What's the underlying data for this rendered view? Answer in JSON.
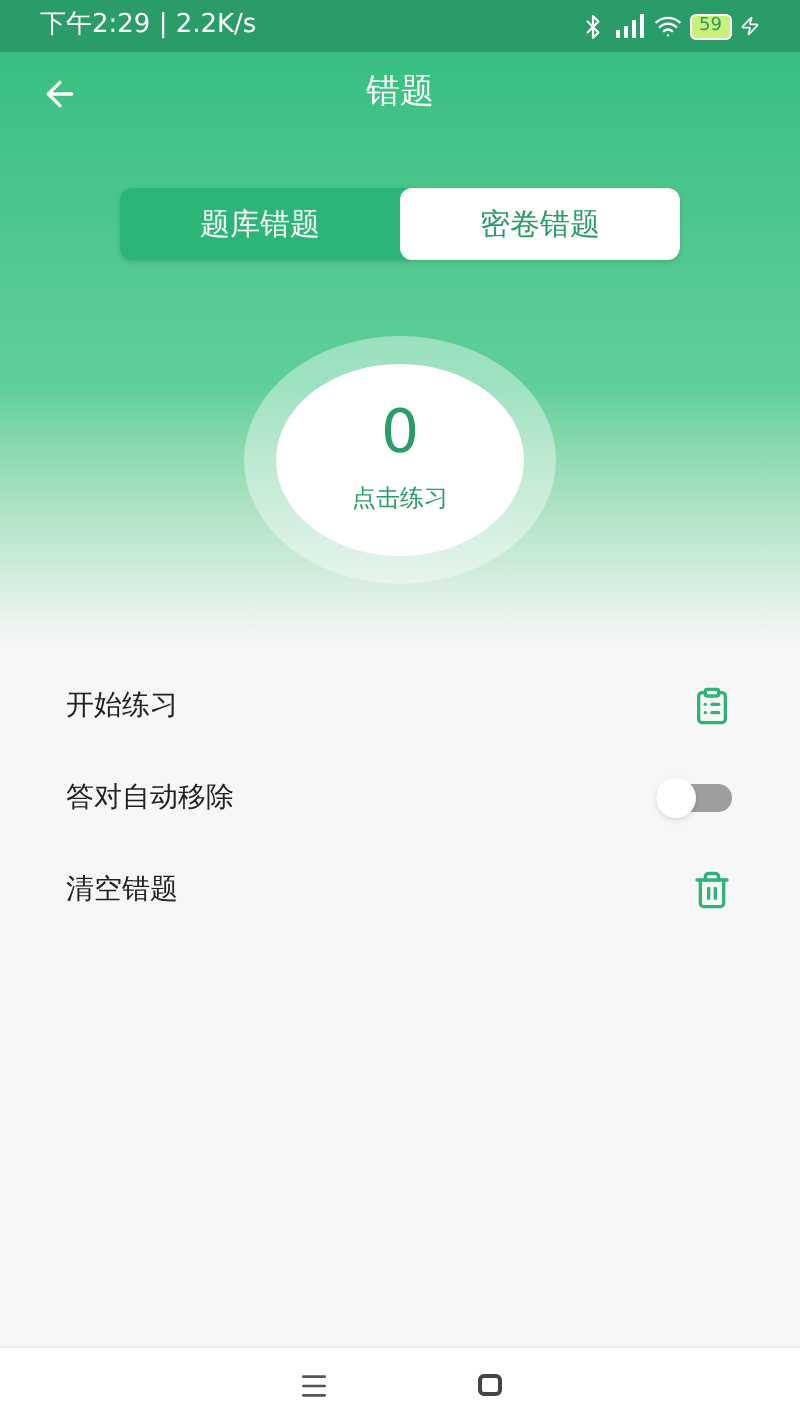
{
  "status_bar": {
    "time": "下午2:29 | 2.2K/s",
    "battery": "59"
  },
  "header": {
    "title": "错题"
  },
  "tabs": [
    {
      "label": "题库错题",
      "selected": false
    },
    {
      "label": "密卷错题",
      "selected": true
    }
  ],
  "counter": {
    "value": "0",
    "caption": "点击练习"
  },
  "rows": [
    {
      "kind": "start",
      "label": "开始练习"
    },
    {
      "kind": "toggle",
      "label": "答对自动移除",
      "on": false
    },
    {
      "kind": "clear",
      "label": "清空错题"
    }
  ]
}
